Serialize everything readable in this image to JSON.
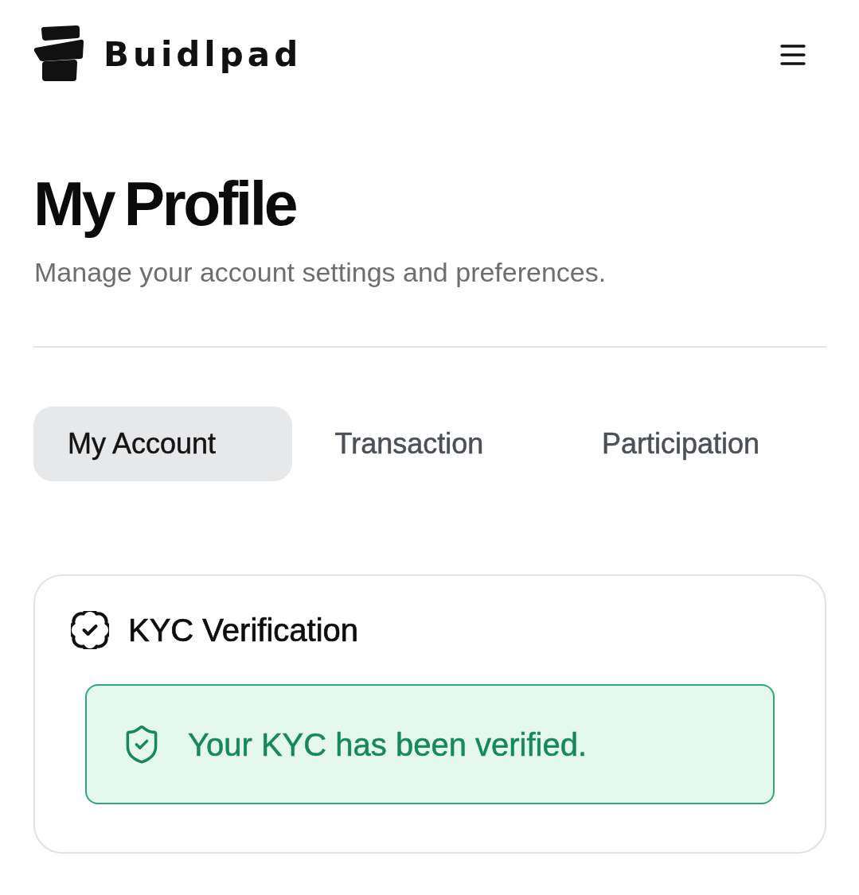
{
  "header": {
    "brand": "Buidlpad"
  },
  "page": {
    "title": "My Profile",
    "subtitle": "Manage your account settings and preferences."
  },
  "tabs": [
    {
      "label": "My Account",
      "selected": true
    },
    {
      "label": "Transaction",
      "selected": false
    },
    {
      "label": "Participation",
      "selected": false
    }
  ],
  "kyc_card": {
    "title": "KYC Verification",
    "status": {
      "kind": "verified",
      "message": "Your KYC has been verified."
    }
  }
}
